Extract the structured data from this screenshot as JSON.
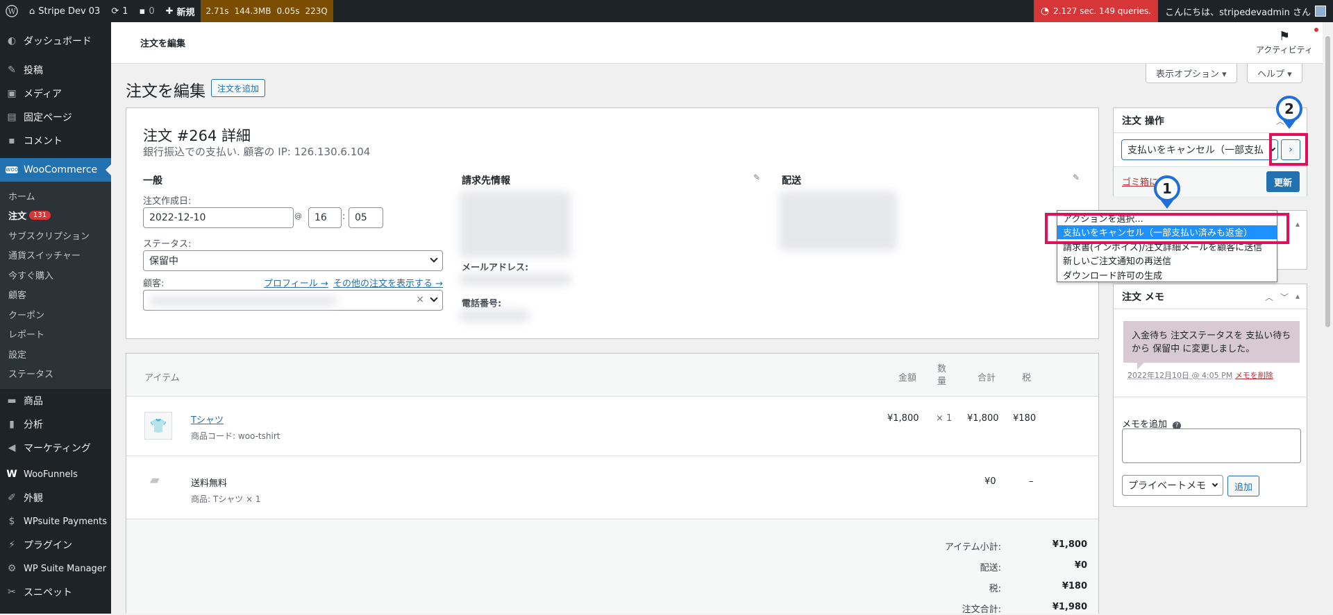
{
  "adminbar": {
    "site": "Stripe Dev 03",
    "updates": "1",
    "comments": "0",
    "new": "新規",
    "perf": [
      "2.71s",
      "144.3MB",
      "0.05s",
      "223Q"
    ],
    "query": "2.127 sec. 149 queries.",
    "howdy": "こんにちは、stripedevadmin さん"
  },
  "sidebar": {
    "items_top": [
      {
        "label": "ダッシュボード",
        "icon": "dashboard-icon"
      },
      {
        "label": "投稿",
        "icon": "pin-icon"
      },
      {
        "label": "メディア",
        "icon": "media-icon"
      },
      {
        "label": "固定ページ",
        "icon": "page-icon"
      },
      {
        "label": "コメント",
        "icon": "comment-icon"
      }
    ],
    "woocommerce": "WooCommerce",
    "sub": [
      "ホーム",
      "注文",
      "サブスクリプション",
      "通貨スイッチャー",
      "今すぐ購入",
      "顧客",
      "クーポン",
      "レポート",
      "設定",
      "ステータス"
    ],
    "orders_badge": "131",
    "items_bottom": [
      {
        "label": "商品",
        "icon": "archive-icon"
      },
      {
        "label": "分析",
        "icon": "chart-icon"
      },
      {
        "label": "マーケティング",
        "icon": "megaphone-icon"
      },
      {
        "label": "WooFunnels",
        "icon": "woofunnels-icon"
      },
      {
        "label": "外観",
        "icon": "brush-icon"
      },
      {
        "label": "WPsuite Payments",
        "icon": "dollar-icon"
      },
      {
        "label": "プラグイン",
        "icon": "plugin-icon"
      },
      {
        "label": "WP Suite Manager",
        "icon": "gear-icon"
      },
      {
        "label": "スニペット",
        "icon": "scissors-icon"
      }
    ]
  },
  "header": {
    "title": "注文を編集",
    "activity": "アクティビティ"
  },
  "screen": {
    "options": "表示オプション ▾",
    "help": "ヘルプ ▾"
  },
  "page": {
    "title": "注文を編集",
    "add_button": "注文を追加"
  },
  "order": {
    "title": "注文 #264 詳細",
    "subtitle": "銀行振込での支払い. 顧客の IP: 126.130.6.104",
    "general": "一般",
    "date_label": "注文作成日:",
    "date": "2022-12-10",
    "at": "@",
    "hour": "16",
    "colon": ":",
    "minute": "05",
    "status_label": "ステータス:",
    "status": "保留中",
    "customer_label": "顧客:",
    "profile_link": "プロフィール →",
    "other_orders_link": "その他の注文を表示する →",
    "billing": "請求先情報",
    "email_label": "メールアドレス:",
    "phone_label": "電話番号:",
    "shipping": "配送"
  },
  "items": {
    "headers": {
      "item": "アイテム",
      "price": "金額",
      "qty": "数量",
      "total": "合計",
      "tax": "税"
    },
    "product": {
      "name": "Tシャツ",
      "sku_label": "商品コード:",
      "sku": "woo-tshirt",
      "price": "¥1,800",
      "qty": "× 1",
      "total": "¥1,800",
      "tax": "¥180"
    },
    "shipping": {
      "name": "送料無料",
      "item_label": "商品:",
      "item": "Tシャツ × 1",
      "total": "¥0",
      "tax": "–"
    },
    "totals": [
      {
        "label": "アイテム小計:",
        "value": "¥1,800"
      },
      {
        "label": "配送:",
        "value": "¥0"
      },
      {
        "label": "税:",
        "value": "¥180"
      },
      {
        "label": "注文合計:",
        "value": "¥1,980"
      }
    ]
  },
  "actions": {
    "title": "注文 操作",
    "selected": "支払いをキャンセル（一部支払",
    "trash": "ゴミ箱に",
    "update": "更新",
    "options": [
      "アクションを選択...",
      "支払いをキャンセル（一部支払い済みも返金）",
      "請求書(インボイス)/注文詳細メールを顧客に送信",
      "新しいご注文通知の再送信",
      "ダウンロード許可の生成"
    ]
  },
  "notes": {
    "title": "注文 メモ",
    "note": "入金待ち 注文ステータスを 支払い待ち から 保留中 に変更しました。",
    "meta": "2022年12月10日 @ 4:05 PM",
    "delete": "メモを削除",
    "add_label": "メモを追加",
    "type": "プライベートメモ",
    "add_button": "追加"
  },
  "markers": [
    "1",
    "2"
  ]
}
